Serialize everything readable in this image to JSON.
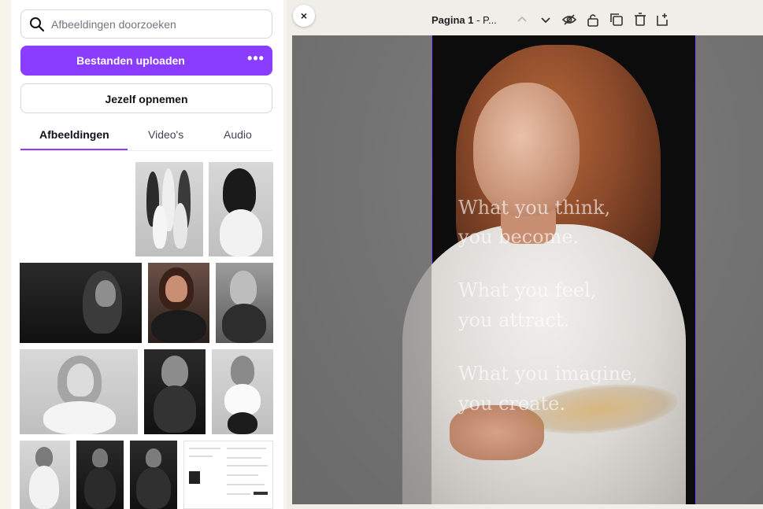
{
  "panel": {
    "search_placeholder": "Afbeeldingen doorzoeken",
    "upload_label": "Bestanden uploaden",
    "upload_more": "•••",
    "record_label": "Jezelf opnemen",
    "tabs": [
      {
        "label": "Afbeeldingen",
        "active": true
      },
      {
        "label": "Video's",
        "active": false
      },
      {
        "label": "Audio",
        "active": false
      }
    ],
    "accent_color": "#8b3dff"
  },
  "editor": {
    "close_label": "×",
    "page_label_bold": "Pagina 1",
    "page_label_rest": " - P...",
    "toolbar_icons": [
      "chevron-up-icon",
      "chevron-down-icon",
      "hide-icon",
      "lock-icon",
      "duplicate-icon",
      "trash-icon",
      "add-page-icon"
    ],
    "quote_lines": [
      "What you think,",
      "you become.",
      "What you feel,",
      "you attract.",
      "What you imagine,",
      "you create."
    ]
  }
}
